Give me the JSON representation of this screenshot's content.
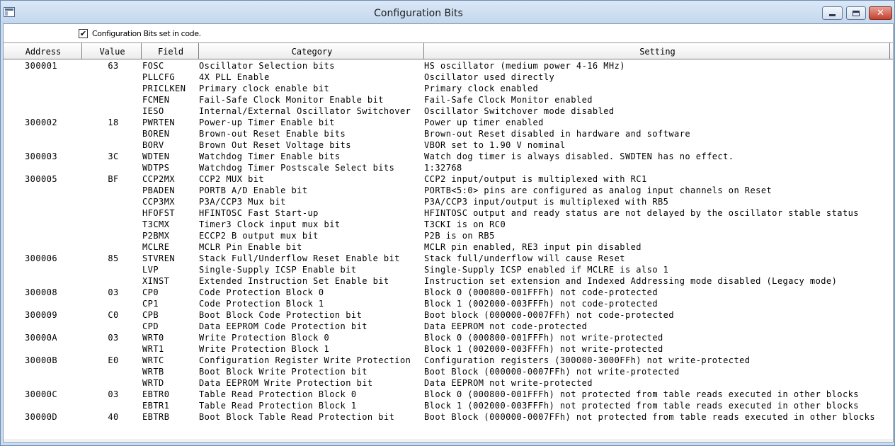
{
  "window": {
    "title": "Configuration Bits"
  },
  "checkbox": {
    "label": "Configuration Bits set in code.",
    "checked_glyph": "✔"
  },
  "columns": [
    "Address",
    "Value",
    "Field",
    "Category",
    "Setting"
  ],
  "rows": [
    {
      "address": "300001",
      "value": "63",
      "field": "FOSC",
      "category": "Oscillator Selection bits",
      "setting": "HS oscillator (medium power 4-16 MHz)"
    },
    {
      "address": "",
      "value": "",
      "field": "PLLCFG",
      "category": "4X PLL Enable",
      "setting": "Oscillator used directly"
    },
    {
      "address": "",
      "value": "",
      "field": "PRICLKEN",
      "category": "Primary clock enable bit",
      "setting": "Primary clock enabled"
    },
    {
      "address": "",
      "value": "",
      "field": "FCMEN",
      "category": "Fail-Safe Clock Monitor Enable bit",
      "setting": "Fail-Safe Clock Monitor enabled"
    },
    {
      "address": "",
      "value": "",
      "field": "IESO",
      "category": "Internal/External Oscillator Switchover",
      "setting": "Oscillator Switchover mode disabled"
    },
    {
      "address": "300002",
      "value": "18",
      "field": "PWRTEN",
      "category": "Power-up Timer Enable bit",
      "setting": "Power up timer enabled"
    },
    {
      "address": "",
      "value": "",
      "field": "BOREN",
      "category": "Brown-out Reset Enable bits",
      "setting": "Brown-out Reset disabled in hardware and software"
    },
    {
      "address": "",
      "value": "",
      "field": "BORV",
      "category": "Brown Out Reset Voltage bits",
      "setting": "VBOR set to 1.90 V nominal"
    },
    {
      "address": "300003",
      "value": "3C",
      "field": "WDTEN",
      "category": "Watchdog Timer Enable bits",
      "setting": "Watch dog timer is always disabled. SWDTEN has no effect."
    },
    {
      "address": "",
      "value": "",
      "field": "WDTPS",
      "category": "Watchdog Timer Postscale Select bits",
      "setting": "1:32768"
    },
    {
      "address": "300005",
      "value": "BF",
      "field": "CCP2MX",
      "category": "CCP2 MUX bit",
      "setting": "CCP2 input/output is multiplexed with RC1"
    },
    {
      "address": "",
      "value": "",
      "field": "PBADEN",
      "category": "PORTB A/D Enable bit",
      "setting": "PORTB<5:0> pins are configured as analog input channels on Reset"
    },
    {
      "address": "",
      "value": "",
      "field": "CCP3MX",
      "category": "P3A/CCP3 Mux bit",
      "setting": "P3A/CCP3 input/output is multiplexed with RB5"
    },
    {
      "address": "",
      "value": "",
      "field": "HFOFST",
      "category": "HFINTOSC Fast Start-up",
      "setting": "HFINTOSC output and ready status are not delayed by the oscillator stable status"
    },
    {
      "address": "",
      "value": "",
      "field": "T3CMX",
      "category": "Timer3 Clock input mux bit",
      "setting": "T3CKI is on RC0"
    },
    {
      "address": "",
      "value": "",
      "field": "P2BMX",
      "category": "ECCP2 B output mux bit",
      "setting": "P2B is on RB5"
    },
    {
      "address": "",
      "value": "",
      "field": "MCLRE",
      "category": "MCLR Pin Enable bit",
      "setting": "MCLR pin enabled, RE3 input pin disabled"
    },
    {
      "address": "300006",
      "value": "85",
      "field": "STVREN",
      "category": "Stack Full/Underflow Reset Enable bit",
      "setting": "Stack full/underflow will cause Reset"
    },
    {
      "address": "",
      "value": "",
      "field": "LVP",
      "category": "Single-Supply ICSP Enable bit",
      "setting": "Single-Supply ICSP enabled if MCLRE is also 1"
    },
    {
      "address": "",
      "value": "",
      "field": "XINST",
      "category": "Extended Instruction Set Enable bit",
      "setting": "Instruction set extension and Indexed Addressing mode disabled (Legacy mode)"
    },
    {
      "address": "300008",
      "value": "03",
      "field": "CP0",
      "category": "Code Protection Block 0",
      "setting": "Block 0 (000800-001FFFh) not code-protected"
    },
    {
      "address": "",
      "value": "",
      "field": "CP1",
      "category": "Code Protection Block 1",
      "setting": "Block 1 (002000-003FFFh) not code-protected"
    },
    {
      "address": "300009",
      "value": "C0",
      "field": "CPB",
      "category": "Boot Block Code Protection bit",
      "setting": "Boot block (000000-0007FFh) not code-protected"
    },
    {
      "address": "",
      "value": "",
      "field": "CPD",
      "category": "Data EEPROM Code Protection bit",
      "setting": "Data EEPROM not code-protected"
    },
    {
      "address": "30000A",
      "value": "03",
      "field": "WRT0",
      "category": "Write Protection Block 0",
      "setting": "Block 0 (000800-001FFFh) not write-protected"
    },
    {
      "address": "",
      "value": "",
      "field": "WRT1",
      "category": "Write Protection Block 1",
      "setting": "Block 1 (002000-003FFFh) not write-protected"
    },
    {
      "address": "30000B",
      "value": "E0",
      "field": "WRTC",
      "category": "Configuration Register Write Protection",
      "setting": "Configuration registers (300000-3000FFh) not write-protected"
    },
    {
      "address": "",
      "value": "",
      "field": "WRTB",
      "category": "Boot Block Write Protection bit",
      "setting": "Boot Block (000000-0007FFh) not write-protected"
    },
    {
      "address": "",
      "value": "",
      "field": "WRTD",
      "category": "Data EEPROM Write Protection bit",
      "setting": "Data EEPROM not write-protected"
    },
    {
      "address": "30000C",
      "value": "03",
      "field": "EBTR0",
      "category": "Table Read Protection Block 0",
      "setting": "Block 0 (000800-001FFFh) not protected from table reads executed in other blocks"
    },
    {
      "address": "",
      "value": "",
      "field": "EBTR1",
      "category": "Table Read Protection Block 1",
      "setting": "Block 1 (002000-003FFFh) not protected from table reads executed in other blocks"
    },
    {
      "address": "30000D",
      "value": "40",
      "field": "EBTRB",
      "category": "Boot Block Table Read Protection bit",
      "setting": "Boot Block (000000-0007FFh) not protected from table reads executed in other blocks"
    }
  ]
}
